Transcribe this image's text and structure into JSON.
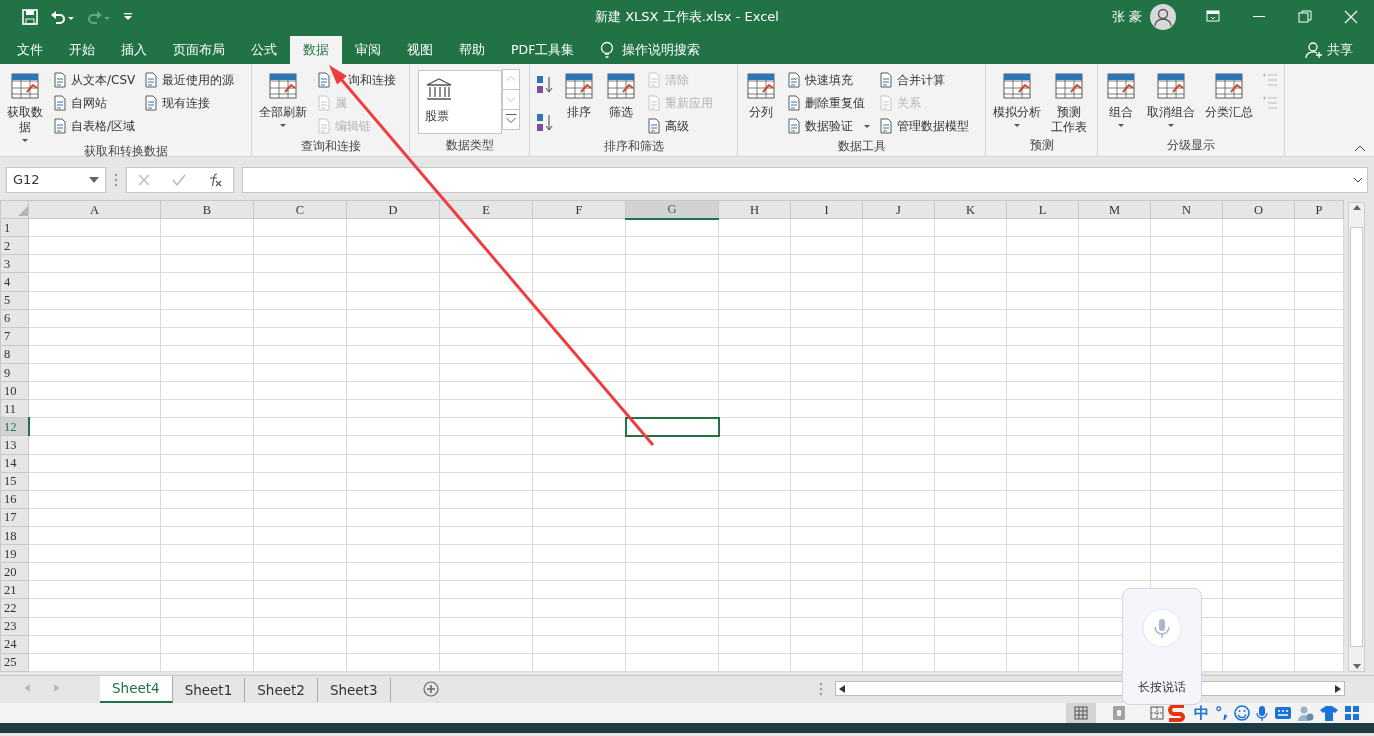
{
  "window": {
    "title": "新建 XLSX 工作表.xlsx  -  Excel",
    "user": "张 豪"
  },
  "ribbon_tabs": [
    {
      "label": "文件",
      "selected": false
    },
    {
      "label": "开始",
      "selected": false
    },
    {
      "label": "插入",
      "selected": false
    },
    {
      "label": "页面布局",
      "selected": false
    },
    {
      "label": "公式",
      "selected": false
    },
    {
      "label": "数据",
      "selected": true
    },
    {
      "label": "审阅",
      "selected": false
    },
    {
      "label": "视图",
      "selected": false
    },
    {
      "label": "帮助",
      "selected": false
    },
    {
      "label": "PDF工具集",
      "selected": false
    }
  ],
  "tell_me": "操作说明搜索",
  "share": "共享",
  "ribbon_groups": [
    {
      "label": "获取和转换数据",
      "columns": [
        {
          "kind": "large",
          "lines": [
            "获取数",
            "据"
          ],
          "dropdown": true
        },
        {
          "kind": "stack",
          "items": [
            {
              "label": "从文本/CSV",
              "disabled": false
            },
            {
              "label": "自网站",
              "disabled": false
            },
            {
              "label": "自表格/区域",
              "disabled": false
            }
          ]
        },
        {
          "kind": "stack",
          "items": [
            {
              "label": "最近使用的源",
              "disabled": false
            },
            {
              "label": "现有连接",
              "disabled": false
            }
          ]
        }
      ]
    },
    {
      "label": "查询和连接",
      "columns": [
        {
          "kind": "large",
          "lines": [
            "全部刷新"
          ],
          "dropdown": true
        },
        {
          "kind": "stack",
          "items": [
            {
              "label": "询和连接",
              "disabled": false
            },
            {
              "label": "属",
              "disabled": true
            },
            {
              "label": "编辑链",
              "disabled": true
            }
          ]
        }
      ]
    },
    {
      "label": "数据类型",
      "columns": [
        {
          "kind": "gallery",
          "label": "股票"
        }
      ]
    },
    {
      "label": "排序和筛选",
      "columns": [
        {
          "kind": "sort"
        },
        {
          "kind": "large",
          "lines": [
            "排序"
          ],
          "dropdown": false
        },
        {
          "kind": "large",
          "lines": [
            "筛选"
          ],
          "dropdown": false
        },
        {
          "kind": "stack",
          "items": [
            {
              "label": "清除",
              "disabled": true
            },
            {
              "label": "重新应用",
              "disabled": true
            },
            {
              "label": "高级",
              "disabled": false
            }
          ]
        }
      ]
    },
    {
      "label": "数据工具",
      "columns": [
        {
          "kind": "large",
          "lines": [
            "分列"
          ],
          "dropdown": false
        },
        {
          "kind": "stack",
          "items": [
            {
              "label": "快速填充",
              "disabled": false
            },
            {
              "label": "删除重复值",
              "disabled": false
            },
            {
              "label": "数据验证",
              "disabled": false,
              "dropdown": true
            }
          ]
        },
        {
          "kind": "stack",
          "items": [
            {
              "label": "合并计算",
              "disabled": false
            },
            {
              "label": "关系",
              "disabled": true
            },
            {
              "label": "管理数据模型",
              "disabled": false
            }
          ]
        }
      ]
    },
    {
      "label": "预测",
      "columns": [
        {
          "kind": "large",
          "lines": [
            "模拟分析"
          ],
          "dropdown": true
        },
        {
          "kind": "large",
          "lines": [
            "预测",
            "工作表"
          ],
          "dropdown": false
        }
      ]
    },
    {
      "label": "分级显示",
      "columns": [
        {
          "kind": "large",
          "lines": [
            "组合"
          ],
          "dropdown": true
        },
        {
          "kind": "large",
          "lines": [
            "取消组合"
          ],
          "dropdown": true
        },
        {
          "kind": "large",
          "lines": [
            "分类汇总"
          ],
          "dropdown": false
        },
        {
          "kind": "detail"
        }
      ]
    }
  ],
  "name_box": "G12",
  "columns": [
    {
      "label": "A",
      "selected": false
    },
    {
      "label": "B",
      "selected": false
    },
    {
      "label": "C",
      "selected": false
    },
    {
      "label": "D",
      "selected": false
    },
    {
      "label": "E",
      "selected": false
    },
    {
      "label": "F",
      "selected": false
    },
    {
      "label": "G",
      "selected": true
    },
    {
      "label": "H",
      "selected": false
    },
    {
      "label": "I",
      "selected": false
    },
    {
      "label": "J",
      "selected": false
    },
    {
      "label": "K",
      "selected": false
    },
    {
      "label": "L",
      "selected": false
    },
    {
      "label": "M",
      "selected": false
    },
    {
      "label": "N",
      "selected": false
    },
    {
      "label": "O",
      "selected": false
    },
    {
      "label": "P",
      "selected": false
    }
  ],
  "rows": [
    {
      "label": "1",
      "selected": false
    },
    {
      "label": "2",
      "selected": false
    },
    {
      "label": "3",
      "selected": false
    },
    {
      "label": "4",
      "selected": false
    },
    {
      "label": "5",
      "selected": false
    },
    {
      "label": "6",
      "selected": false
    },
    {
      "label": "7",
      "selected": false
    },
    {
      "label": "8",
      "selected": false
    },
    {
      "label": "9",
      "selected": false
    },
    {
      "label": "10",
      "selected": false
    },
    {
      "label": "11",
      "selected": false
    },
    {
      "label": "12",
      "selected": true
    },
    {
      "label": "13",
      "selected": false
    },
    {
      "label": "14",
      "selected": false
    },
    {
      "label": "15",
      "selected": false
    },
    {
      "label": "16",
      "selected": false
    },
    {
      "label": "17",
      "selected": false
    },
    {
      "label": "18",
      "selected": false
    },
    {
      "label": "19",
      "selected": false
    },
    {
      "label": "20",
      "selected": false
    },
    {
      "label": "21",
      "selected": false
    },
    {
      "label": "22",
      "selected": false
    },
    {
      "label": "23",
      "selected": false
    },
    {
      "label": "24",
      "selected": false
    },
    {
      "label": "25",
      "selected": false
    }
  ],
  "sheets": [
    {
      "label": "Sheet4",
      "selected": true
    },
    {
      "label": "Sheet1",
      "selected": false
    },
    {
      "label": "Sheet2",
      "selected": false
    },
    {
      "label": "Sheet3",
      "selected": false
    }
  ],
  "view_buttons": [
    {
      "selected": true
    },
    {
      "selected": false
    },
    {
      "selected": false
    }
  ],
  "ime": {
    "mode": "中",
    "punctuation": "°,",
    "popup": "长按说话"
  }
}
